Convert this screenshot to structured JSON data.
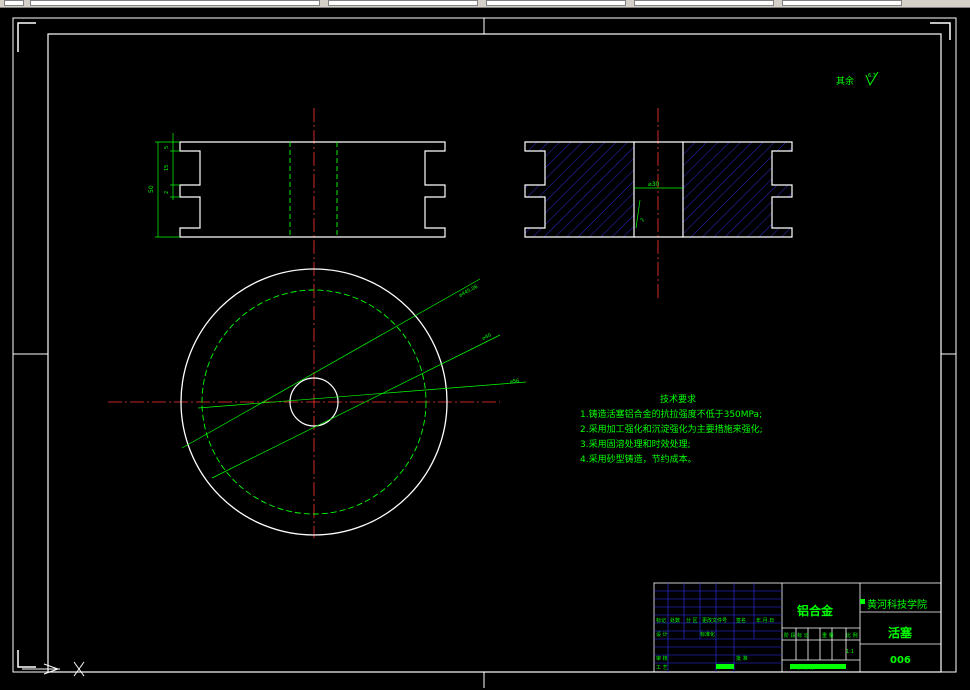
{
  "surface_finish": {
    "label": "其余",
    "value": "6.3"
  },
  "dimensions": {
    "overall_height": "50",
    "groove_width_1": "5",
    "groove_width_2": "2",
    "groove_pitch": "15",
    "bore_diameter": "⌀30",
    "chamfer": "2",
    "dia_outer": "⌀445.06",
    "dia_mid": "⌀40",
    "dia_inner": "⌀56"
  },
  "tech_requirements": {
    "title": "技术要求",
    "items": [
      "1.铸造活塞铝合金的抗拉强度不低于350MPa;",
      "2.采用加工强化和沉淀强化为主要措施来强化;",
      "3.采用固溶处理和时效处理;",
      "4.采用砂型铸造，节约成本。"
    ]
  },
  "title_block": {
    "material": "铝合金",
    "school": "黄河科技学院",
    "part_name": "活塞",
    "drawing_no": "006",
    "scale": "1:1",
    "col_headers": [
      "标记",
      "处数",
      "分 区",
      "更改文件号",
      "签名",
      "年.月.日"
    ],
    "rows": [
      "设 计",
      "标准化",
      "审 核",
      "工 艺"
    ],
    "stage_labels": [
      "阶 段 标 记",
      "重 量",
      "比 例"
    ],
    "approve": "批 准",
    "sheet_info": "共 张 第 张"
  },
  "colors": {
    "outline": "#ffffff",
    "hidden_line": "#00ff00",
    "center_line": "#ff3333",
    "dimension": "#00ff00",
    "hatch": "#3333ff"
  }
}
